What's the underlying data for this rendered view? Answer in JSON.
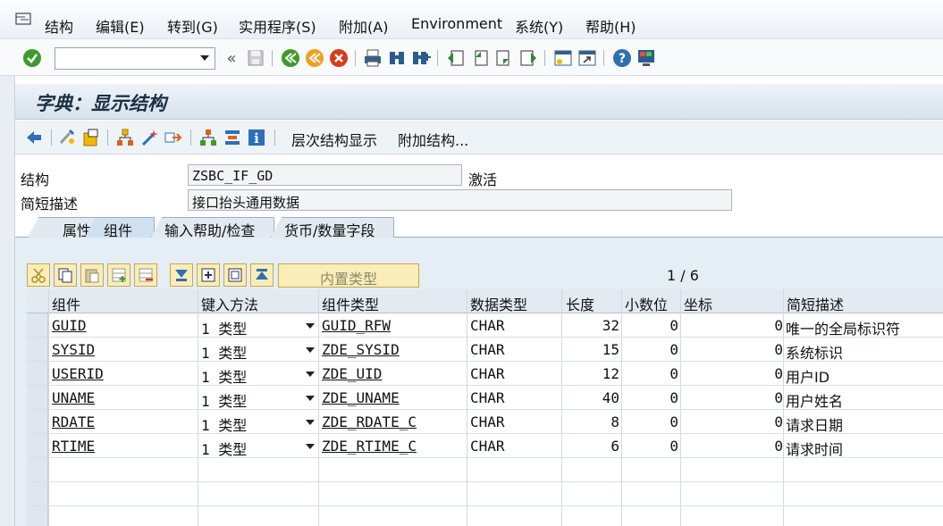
{
  "menu": {
    "items": [
      "结构",
      "编辑(E)",
      "转到(G)",
      "实用程序(S)",
      "附加(A)",
      "Environment",
      "系统(Y)",
      "帮助(H)"
    ]
  },
  "toolbar": {
    "command_value": "",
    "icons": [
      "check-icon",
      "back-nav-icon",
      "save-icon",
      "back-icon",
      "exit-icon",
      "cancel-icon",
      "print-icon",
      "find-icon",
      "find-next-icon",
      "first-page-icon",
      "prev-page-icon",
      "next-page-icon",
      "last-page-icon",
      "new-session-icon",
      "shortcut-icon",
      "help-icon",
      "customize-icon"
    ]
  },
  "title": "字典：显示结构",
  "app_toolbar": {
    "hierarchy_label": "层次结构显示",
    "append_label": "附加结构..."
  },
  "header": {
    "structure_label": "结构",
    "structure_value": "ZSBC_IF_GD",
    "status": "激活",
    "desc_label": "简短描述",
    "desc_value": "接口抬头通用数据"
  },
  "tabs": [
    "属性",
    "组件",
    "输入帮助/检查",
    "货币/数量字段"
  ],
  "table_toolbar": {
    "builtin_type_label": "内置类型",
    "page_indicator": "1 / 6"
  },
  "grid": {
    "columns": [
      "组件",
      "键入方法",
      "组件类型",
      "数据类型",
      "长度",
      "小数位",
      "坐标",
      "简短描述"
    ],
    "rows": [
      {
        "component": "GUID",
        "method": "1 类型",
        "comp_type": "GUID_RFW",
        "data_type": "CHAR",
        "length": "32",
        "decimals": "0",
        "coord": "0",
        "desc": "唯一的全局标识符"
      },
      {
        "component": "SYSID",
        "method": "1 类型",
        "comp_type": "ZDE_SYSID",
        "data_type": "CHAR",
        "length": "15",
        "decimals": "0",
        "coord": "0",
        "desc": "系统标识"
      },
      {
        "component": "USERID",
        "method": "1 类型",
        "comp_type": "ZDE_UID",
        "data_type": "CHAR",
        "length": "12",
        "decimals": "0",
        "coord": "0",
        "desc": "用户ID"
      },
      {
        "component": "UNAME",
        "method": "1 类型",
        "comp_type": "ZDE_UNAME",
        "data_type": "CHAR",
        "length": "40",
        "decimals": "0",
        "coord": "0",
        "desc": "用户姓名"
      },
      {
        "component": "RDATE",
        "method": "1 类型",
        "comp_type": "ZDE_RDATE_C",
        "data_type": "CHAR",
        "length": "8",
        "decimals": "0",
        "coord": "0",
        "desc": "请求日期"
      },
      {
        "component": "RTIME",
        "method": "1 类型",
        "comp_type": "ZDE_RTIME_C",
        "data_type": "CHAR",
        "length": "6",
        "decimals": "0",
        "coord": "0",
        "desc": "请求时间"
      }
    ]
  },
  "colors": {
    "accent": "#2a6cb8",
    "tab_active": "#cfe0f1",
    "button_yellow": "#fbedb7"
  }
}
